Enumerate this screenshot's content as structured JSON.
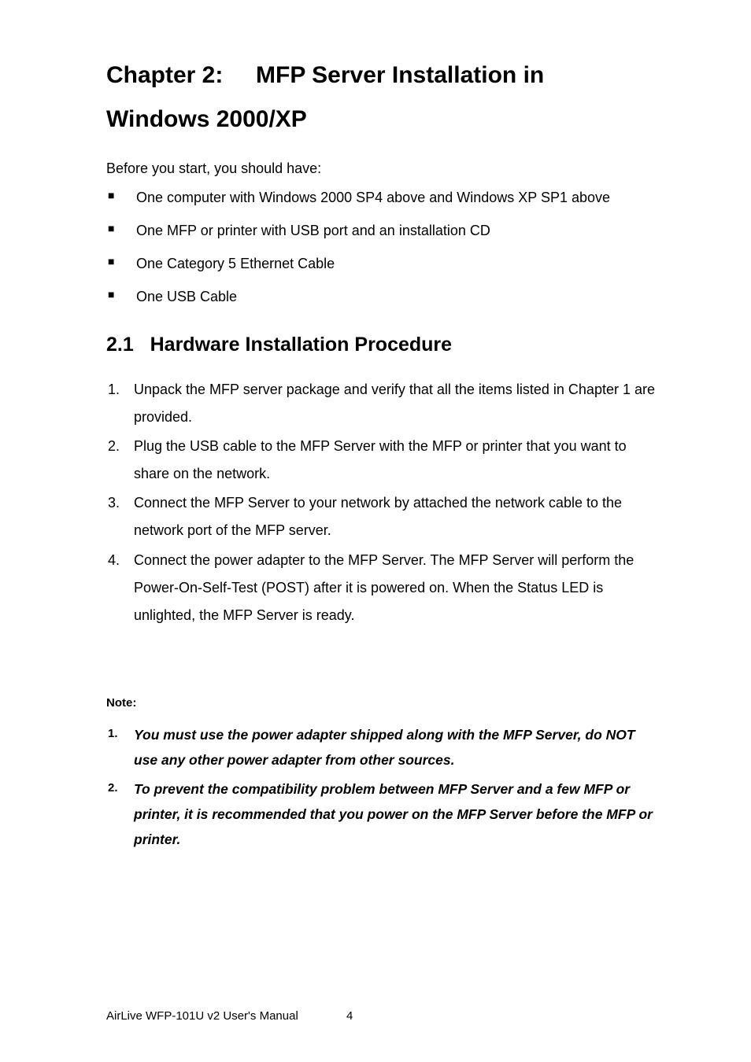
{
  "chapter": {
    "title_line1": "Chapter 2:     MFP Server Installation in",
    "title_line2": "Windows 2000/XP"
  },
  "intro": "Before you start, you should have:",
  "bullets": [
    "One computer with Windows 2000 SP4 above and Windows XP SP1 above",
    "One MFP or printer with USB port and an installation CD",
    "One Category 5 Ethernet Cable",
    "One USB Cable"
  ],
  "section": {
    "number": "2.1",
    "title": "Hardware Installation Procedure"
  },
  "steps": [
    "Unpack the MFP server package and verify that all the items listed in Chapter 1 are provided.",
    "Plug the USB cable to the MFP Server with the MFP or printer that you want to share on the network.",
    "Connect the MFP Server to your network by attached the network cable to the network port of the MFP server.",
    "Connect the power adapter to the MFP Server. The MFP Server will perform the Power-On-Self-Test (POST) after it is powered on. When the Status LED is unlighted, the MFP Server is ready."
  ],
  "note_label": "Note:",
  "notes": [
    "You must use the power adapter shipped along with the MFP Server, do NOT use any other power adapter from other sources.",
    "To prevent the compatibility problem between MFP Server and a few MFP or printer, it is recommended that you power on the MFP Server before the MFP or printer."
  ],
  "footer": {
    "text": "AirLive WFP-101U v2 User's Manual",
    "page": "4"
  }
}
